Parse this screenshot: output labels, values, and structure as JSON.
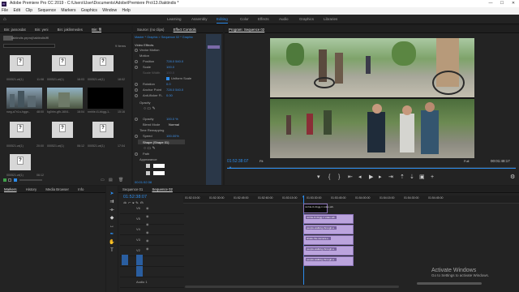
{
  "window": {
    "title": "Adobe Premiere Pro CC 2019 - C:\\Users\\User\\Documents\\Adobe\\Premiere Pro\\13.0\\aktindis *",
    "minimize": "—",
    "maximize": "☐",
    "close": "✕"
  },
  "menu": [
    "File",
    "Edit",
    "Clip",
    "Sequence",
    "Markers",
    "Graphics",
    "Window",
    "Help"
  ],
  "workspaces": [
    "Learning",
    "Assembly",
    "Editing",
    "Color",
    "Effects",
    "Audio",
    "Graphics",
    "Libraries"
  ],
  "active_workspace": "Editing",
  "project_panel": {
    "tabs": [
      "Bin: jassosdat",
      "Bin: yeni",
      "Bin: jaklinmedes",
      "Bin: ffl"
    ],
    "path": "/aktindis.prproj/\\aktindis\\ffl",
    "count": "9 Items",
    "items": [
      {
        "name": "000521.wl(1)",
        "dur": "11:08",
        "kind": "missing"
      },
      {
        "name": "000521.wl(1)",
        "dur": "16:03",
        "kind": "missing"
      },
      {
        "name": "000521.wl(1)",
        "dur": "18:02",
        "kind": "missing"
      },
      {
        "name": "000521.wl(1)",
        "dur": "05:12",
        "kind": "missing"
      },
      {
        "name": "nwg-a7r4-s-hggn..",
        "dur": "48:00",
        "kind": "video"
      },
      {
        "name": "kg0rlm-gfh-1604..",
        "dur": "16:04",
        "kind": "video"
      },
      {
        "name": "nmhle-t1-bkgg-1..",
        "dur": "15:16",
        "kind": "black"
      },
      {
        "name": "000521.wl(1)",
        "dur": "20:00",
        "kind": "missing"
      },
      {
        "name": "000521.wl(1)",
        "dur": "06:12",
        "kind": "missing"
      },
      {
        "name": "000521.wl(1)",
        "dur": "17:04",
        "kind": "missing"
      },
      {
        "name": "000521.wl(1)",
        "dur": "06:12",
        "kind": "missing"
      }
    ]
  },
  "effect_controls": {
    "tabs": [
      "Source: (no clips)",
      "Effect Controls",
      "Audio Clip Mixer"
    ],
    "header": "Master * Graphic  >  Sequence 02 * Graphic",
    "section": "Video Effects",
    "rows": [
      {
        "label": "Vector Motion",
        "value": "",
        "indent": 0
      },
      {
        "label": "Motion",
        "value": "",
        "indent": 0
      },
      {
        "label": "Position",
        "value": "728.0   540.0",
        "indent": 1
      },
      {
        "label": "Scale",
        "value": "100.0",
        "indent": 1
      },
      {
        "label": "Scale Width",
        "value": "100.0",
        "indent": 1
      },
      {
        "label": "Uniform Scale",
        "value": "",
        "indent": 2
      },
      {
        "label": "Rotation",
        "value": "0.0",
        "indent": 1
      },
      {
        "label": "Anchor Point",
        "value": "728.0   540.0",
        "indent": 1
      },
      {
        "label": "Anti-flicker Fi..",
        "value": "0.00",
        "indent": 1
      },
      {
        "label": "Opacity",
        "value": "",
        "indent": 0
      },
      {
        "label": "Opacity",
        "value": "100.0 %",
        "indent": 1
      },
      {
        "label": "Blend Mode",
        "value": "Normal",
        "indent": 1
      },
      {
        "label": "Time Remapping",
        "value": "",
        "indent": 0
      },
      {
        "label": "Speed",
        "value": "100.00%",
        "indent": 1
      },
      {
        "label": "Shape (Shape 01)",
        "value": "",
        "indent": 0
      },
      {
        "label": "Path",
        "value": "",
        "indent": 1
      },
      {
        "label": "Appearance",
        "value": "",
        "indent": 1
      }
    ],
    "timecode": "00:01:52:38"
  },
  "program_monitor": {
    "title": "Program: Sequence 02",
    "timecode": "01:52:38:07",
    "fit": "Fit",
    "quality": "Full",
    "duration": "00:01:48:17"
  },
  "timeline": {
    "left_tabs": [
      "Markers",
      "History",
      "Media Browser",
      "Info"
    ],
    "tabs": [
      "Sequence 01",
      "Sequence 02"
    ],
    "timecode": "01:52:38:07",
    "ruler": [
      "01:52:15:00",
      "01:52:30:00",
      "01:52:45:00",
      "01:52:60:00",
      "01:53:15:00",
      "01:53:30:00",
      "01:53:45:00",
      "01:54:00:00",
      "01:54:15:00",
      "01:54:30:00",
      "01:54:45:00"
    ],
    "tracks": [
      {
        "name": "V6",
        "type": "video"
      },
      {
        "name": "V5",
        "type": "video"
      },
      {
        "name": "V4",
        "type": "video"
      },
      {
        "name": "V3",
        "type": "video"
      },
      {
        "name": "V2",
        "type": "video"
      },
      {
        "name": "V1",
        "type": "video"
      },
      {
        "name": "A1",
        "type": "audio"
      },
      {
        "name": "Audio 1",
        "type": "audio"
      }
    ],
    "clips": [
      {
        "label": "nmhle-t1-bkgg-1 video-wlt..",
        "track": 0
      },
      {
        "label": "people-walking-through-a..",
        "track": 1
      },
      {
        "label": "shake-the-camera-e..",
        "track": 2
      },
      {
        "label": "people-walking-through-a..",
        "track": 3
      },
      {
        "label": "people-walking-through-a..",
        "track": 4
      }
    ]
  },
  "watermark": {
    "line1": "Activate Windows",
    "line2": "Go to Settings to activate Windows."
  }
}
